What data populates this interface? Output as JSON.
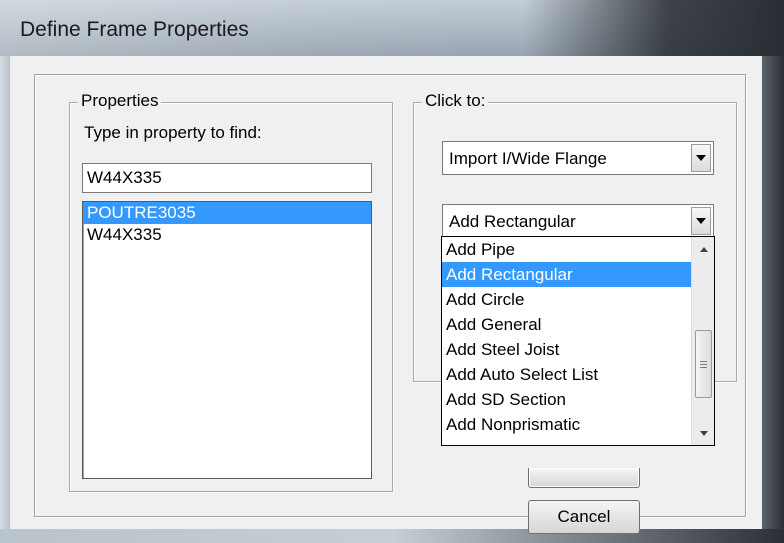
{
  "window": {
    "title": "Define Frame Properties"
  },
  "properties": {
    "group_label": "Properties",
    "find_label": "Type in property to find:",
    "find_value": "W44X335",
    "items": [
      {
        "label": "POUTRE3035",
        "selected": true
      },
      {
        "label": "W44X335",
        "selected": false
      }
    ]
  },
  "click_to": {
    "group_label": "Click to:",
    "import_combo": "Import I/Wide Flange",
    "add_combo": "Add Rectangular",
    "dropdown_items": [
      {
        "label": "Add Pipe",
        "selected": false
      },
      {
        "label": "Add Rectangular",
        "selected": true
      },
      {
        "label": "Add Circle",
        "selected": false
      },
      {
        "label": "Add General",
        "selected": false
      },
      {
        "label": "Add Steel Joist",
        "selected": false
      },
      {
        "label": "Add Auto Select List",
        "selected": false
      },
      {
        "label": "Add SD Section",
        "selected": false
      },
      {
        "label": "Add Nonprismatic",
        "selected": false
      }
    ]
  },
  "buttons": {
    "cancel": "Cancel"
  },
  "colors": {
    "selection": "#3399ff",
    "dialog_bg": "#f0f0f0"
  }
}
